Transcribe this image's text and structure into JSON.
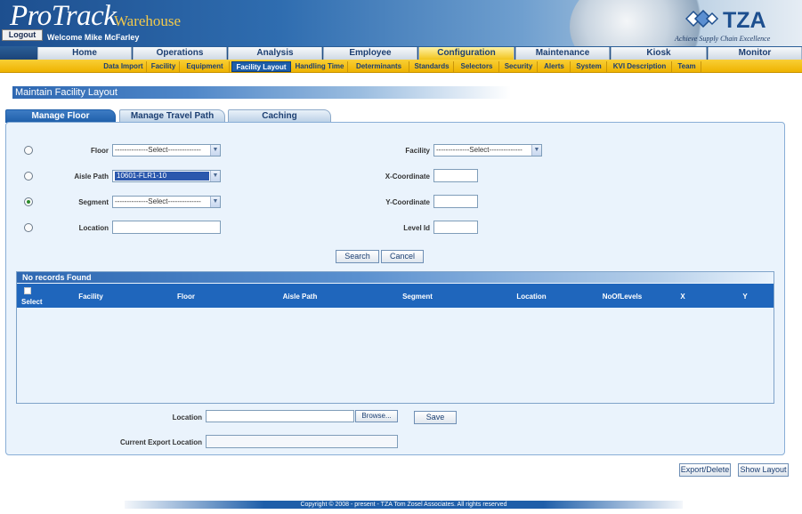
{
  "header": {
    "logo_main": "ProTrack",
    "logo_sub": "Warehouse",
    "logout_label": "Logout",
    "welcome": "Welcome Mike McFarley",
    "brand": "TZA",
    "tagline": "Achieve Supply Chain Excellence"
  },
  "main_nav": [
    {
      "label": "Home",
      "active": false
    },
    {
      "label": "Operations",
      "active": false
    },
    {
      "label": "Analysis",
      "active": false
    },
    {
      "label": "Employee",
      "active": false
    },
    {
      "label": "Configuration",
      "active": true
    },
    {
      "label": "Maintenance",
      "active": false
    },
    {
      "label": "Kiosk",
      "active": false
    },
    {
      "label": "Monitor",
      "active": false
    }
  ],
  "sub_nav": [
    {
      "label": "Data Import",
      "active": false
    },
    {
      "label": "Facility",
      "active": false
    },
    {
      "label": "Equipment",
      "active": false
    },
    {
      "label": "Facility Layout",
      "active": true
    },
    {
      "label": "Handling Time",
      "active": false
    },
    {
      "label": "Determinants",
      "active": false
    },
    {
      "label": "Standards",
      "active": false
    },
    {
      "label": "Selectors",
      "active": false
    },
    {
      "label": "Security",
      "active": false
    },
    {
      "label": "Alerts",
      "active": false
    },
    {
      "label": "System",
      "active": false
    },
    {
      "label": "KVI Description",
      "active": false
    },
    {
      "label": "Team",
      "active": false
    }
  ],
  "page_title": "Maintain Facility Layout",
  "form_tabs": [
    {
      "label": "Manage Floor",
      "active": true
    },
    {
      "label": "Manage Travel Path",
      "active": false
    },
    {
      "label": "Caching",
      "active": false
    }
  ],
  "form": {
    "floor_label": "Floor",
    "floor_value": "--------------Select--------------",
    "aisle_label": "Aisle Path",
    "aisle_value": "10601-FLR1-10",
    "segment_label": "Segment",
    "segment_value": "--------------Select--------------",
    "location_label": "Location",
    "location_value": "",
    "facility_label": "Facility",
    "facility_value": "--------------Select--------------",
    "x_label": "X-Coordinate",
    "x_value": "",
    "y_label": "Y-Coordinate",
    "y_value": "",
    "level_label": "Level Id",
    "level_value": "",
    "selected_radio": "segment",
    "search_label": "Search",
    "cancel_label": "Cancel"
  },
  "grid": {
    "caption": "No records Found",
    "select_label": "Select",
    "columns": [
      "Facility",
      "Floor",
      "Aisle Path",
      "Segment",
      "Location",
      "NoOfLevels",
      "X",
      "Y"
    ],
    "rows": []
  },
  "export": {
    "location_label": "Location",
    "location_value": "",
    "browse_label": "Browse...",
    "save_label": "Save",
    "current_label": "Current Export Location",
    "current_value": ""
  },
  "actions": {
    "export_delete_label": "Export/Delete",
    "show_layout_label": "Show Layout"
  },
  "footer": "Copyright © 2008 - present - TZA Tom Zosel Associates. All rights reserved"
}
